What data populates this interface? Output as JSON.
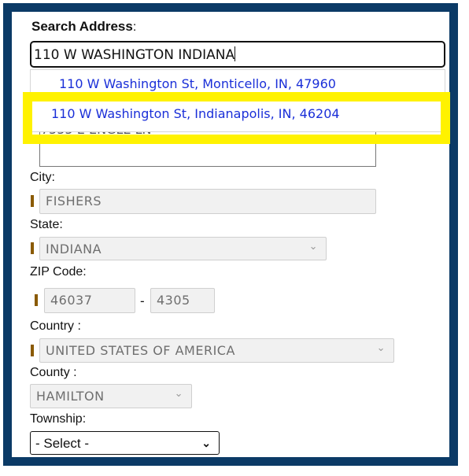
{
  "search": {
    "label": "Search Address",
    "colon": ":",
    "value": "110 W WASHINGTON INDIANA"
  },
  "suggestions": [
    "110 W Washington St, Monticello, IN, 47960",
    "110 W Washington St, Indianapolis, IN, 46204"
  ],
  "address_partial": "7555 E ENGLE LN",
  "city": {
    "label": "City:",
    "value": "FISHERS"
  },
  "state": {
    "label": "State:",
    "value": "INDIANA"
  },
  "zip": {
    "label": "ZIP Code:",
    "value": "46037",
    "dash": "-",
    "ext": "4305"
  },
  "country": {
    "label": "Country :",
    "value": "UNITED STATES OF AMERICA"
  },
  "county": {
    "label": "County :",
    "value": "HAMILTON"
  },
  "township": {
    "label": "Township:",
    "value": "- Select -"
  },
  "colors": {
    "frame": "#0b3a66",
    "highlight": "#fff200",
    "link": "#1a2fd8",
    "required_mark": "#8a5a00"
  }
}
